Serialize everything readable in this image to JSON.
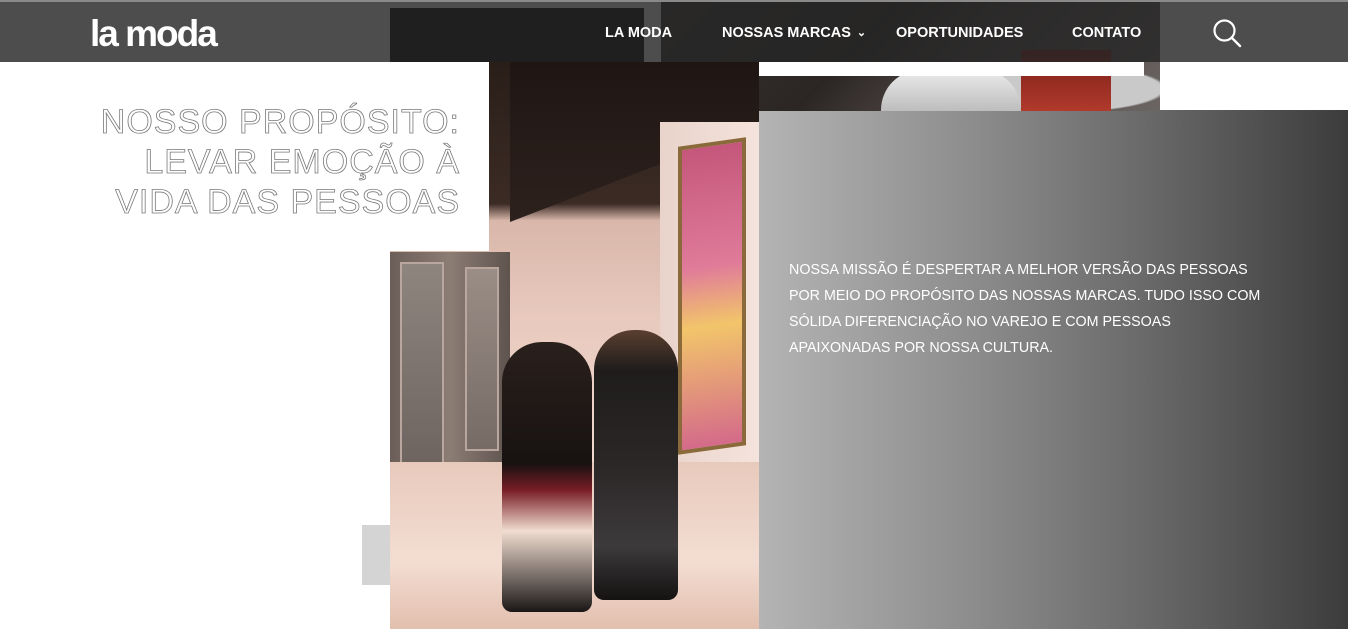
{
  "header": {
    "logo": "la moda",
    "nav": [
      {
        "label": "LA MODA"
      },
      {
        "label": "NOSSAS MARCAS",
        "dropdown": true
      },
      {
        "label": "OPORTUNIDADES"
      },
      {
        "label": "CONTATO"
      }
    ],
    "search_icon": "search-icon"
  },
  "hero": {
    "title_lines": [
      "NOSSO PROPÓSITO:",
      "LEVAR EMOÇÃO À",
      "VIDA DAS PESSOAS"
    ],
    "mission": "NOSSA MISSÃO É DESPERTAR A MELHOR VERSÃO DAS PESSOAS POR MEIO DO PROPÓSITO DAS NOSSAS MARCAS. TUDO ISSO COM SÓLIDA DIFERENCIAÇÃO NO VAREJO E COM PESSOAS APAIXONADAS POR NOSSA CULTURA."
  },
  "colors": {
    "header_bg": "#262626",
    "title_outline": "#7a7a7a",
    "gradient_start": "#b4b4b4",
    "gradient_end": "#3c3c3c",
    "accent_grey": "#d4d4d4"
  }
}
